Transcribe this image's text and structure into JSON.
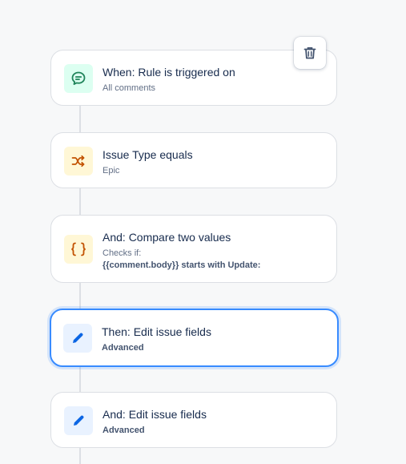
{
  "toolbar": {
    "delete_icon": "trash-icon"
  },
  "steps": [
    {
      "title": "When: Rule is triggered on",
      "subtitle": "All comments",
      "icon": "comment-icon",
      "icon_color": "#1f845a",
      "icon_bg": "#dcfff1"
    },
    {
      "title": "Issue Type equals",
      "subtitle": "Epic",
      "icon": "shuffle-icon",
      "icon_color": "#c25100",
      "icon_bg": "#fff7d6"
    },
    {
      "title": "And: Compare two values",
      "subtitle": "Checks if:",
      "detail": "{{comment.body}} starts with Update:",
      "icon": "braces-icon",
      "icon_color": "#c25100",
      "icon_bg": "#fff7d6"
    },
    {
      "title": "Then: Edit issue fields",
      "subtitle": "Advanced",
      "icon": "pencil-icon",
      "icon_color": "#0c66e4",
      "icon_bg": "#e9f2ff",
      "selected": true
    },
    {
      "title": "And: Edit issue fields",
      "subtitle": "Advanced",
      "icon": "pencil-icon",
      "icon_color": "#0c66e4",
      "icon_bg": "#e9f2ff"
    }
  ]
}
